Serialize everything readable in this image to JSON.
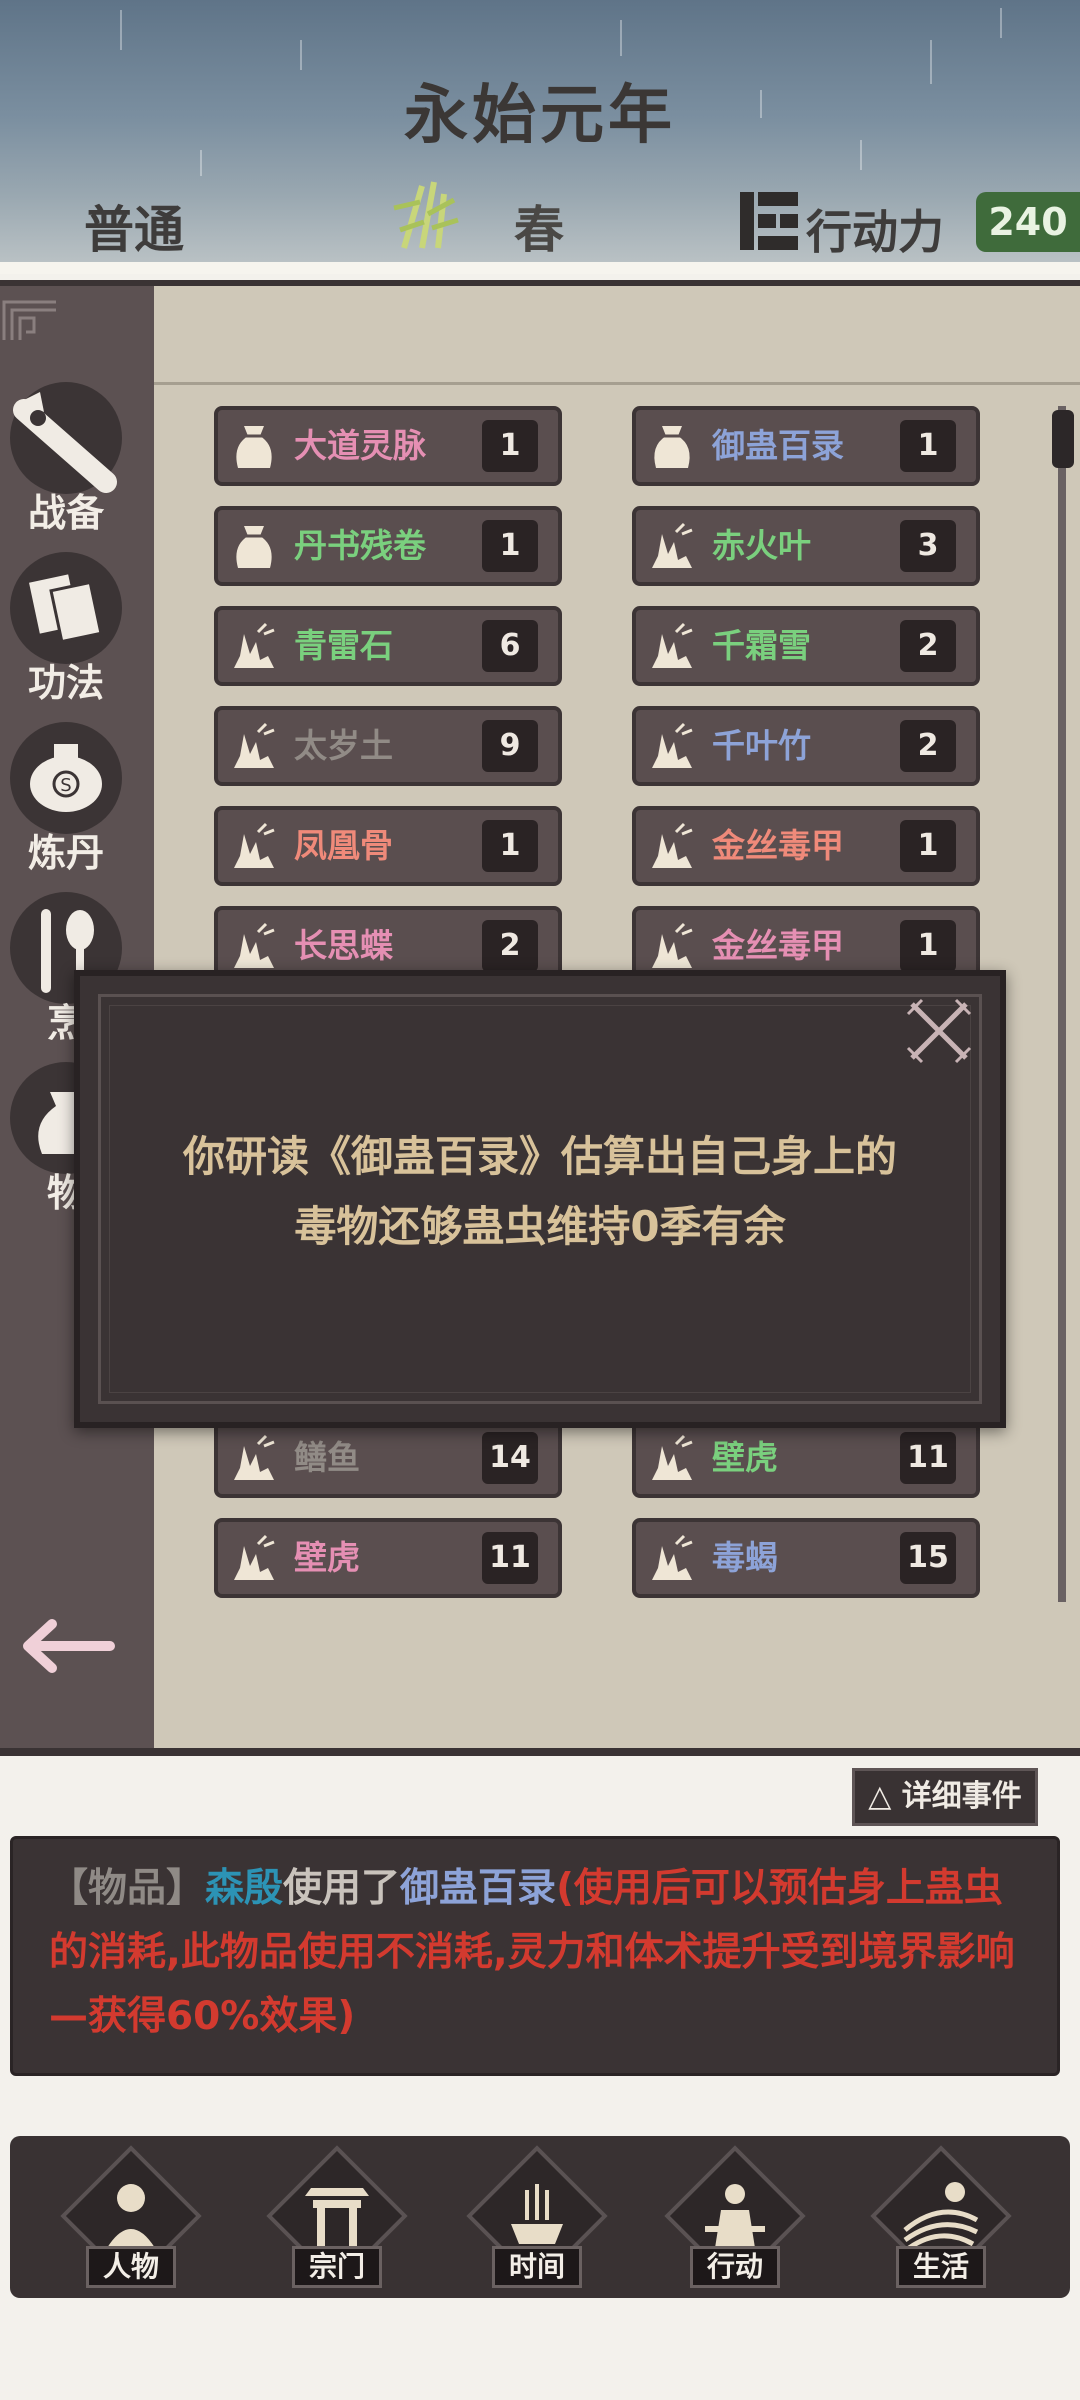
{
  "header": {
    "year_title": "永始元年",
    "difficulty": "普通",
    "season": "春",
    "action_points_label": "行动力",
    "action_points_value": "240"
  },
  "sidebar": {
    "categories": [
      {
        "label": "战备",
        "icon": "sword-icon"
      },
      {
        "label": "功法",
        "icon": "scroll-icon"
      },
      {
        "label": "炼丹",
        "icon": "cauldron-icon"
      },
      {
        "label": "烹",
        "icon": "spoon-icon"
      },
      {
        "label": "物",
        "icon": "bag-icon"
      }
    ]
  },
  "items": [
    {
      "name": "大道灵脉",
      "count": "1",
      "color": "#e58fb3",
      "icon": "bag-icon"
    },
    {
      "name": "御蛊百录",
      "count": "1",
      "color": "#8da3d8",
      "icon": "bag-icon"
    },
    {
      "name": "丹书残卷",
      "count": "1",
      "color": "#7ad07e",
      "icon": "bag-icon"
    },
    {
      "name": "赤火叶",
      "count": "3",
      "color": "#7ad07e",
      "icon": "herb-icon"
    },
    {
      "name": "青雷石",
      "count": "6",
      "color": "#7ad07e",
      "icon": "herb-icon"
    },
    {
      "name": "千霜雪",
      "count": "2",
      "color": "#7ad07e",
      "icon": "herb-icon"
    },
    {
      "name": "太岁土",
      "count": "9",
      "color": "#918b86",
      "icon": "herb-icon"
    },
    {
      "name": "千叶竹",
      "count": "2",
      "color": "#8da3d8",
      "icon": "herb-icon"
    },
    {
      "name": "凤凰骨",
      "count": "1",
      "color": "#ef8a7a",
      "icon": "herb-icon"
    },
    {
      "name": "金丝毒甲",
      "count": "1",
      "color": "#ef8a7a",
      "icon": "herb-icon"
    },
    {
      "name": "长思蝶",
      "count": "2",
      "color": "#e58fb3",
      "icon": "herb-icon"
    },
    {
      "name": "金丝毒甲",
      "count": "1",
      "color": "#e58fb3",
      "icon": "herb-icon"
    },
    {
      "name": "鳝鱼",
      "count": "14",
      "color": "#918b86",
      "icon": "herb-icon"
    },
    {
      "name": "壁虎",
      "count": "11",
      "color": "#7ad07e",
      "icon": "herb-icon"
    },
    {
      "name": "壁虎",
      "count": "11",
      "color": "#e58fb3",
      "icon": "herb-icon"
    },
    {
      "name": "毒蝎",
      "count": "15",
      "color": "#8da3d8",
      "icon": "herb-icon"
    }
  ],
  "modal": {
    "line1": "你研读《御蛊百录》估算出自己身上的",
    "line2": "毒物还够蛊虫维持0季有余"
  },
  "log": {
    "detail_button": "△ 详细事件",
    "tag": "【物品】",
    "name": "森殷",
    "verb": "使用了",
    "item": "御蛊百录",
    "effect": "(使用后可以预估身上蛊虫的消耗,此物品使用不消耗,灵力和体术提升受到境界影响—获得60%效果)"
  },
  "nav": [
    {
      "label": "人物",
      "icon": "person-icon"
    },
    {
      "label": "宗门",
      "icon": "gate-icon"
    },
    {
      "label": "时间",
      "icon": "incense-icon"
    },
    {
      "label": "行动",
      "icon": "action-icon"
    },
    {
      "label": "生活",
      "icon": "landscape-icon"
    }
  ],
  "colors": {
    "accent_green": "#3f6b3b",
    "log_red": "#d33a2f",
    "modal_text": "#d8c29a"
  }
}
